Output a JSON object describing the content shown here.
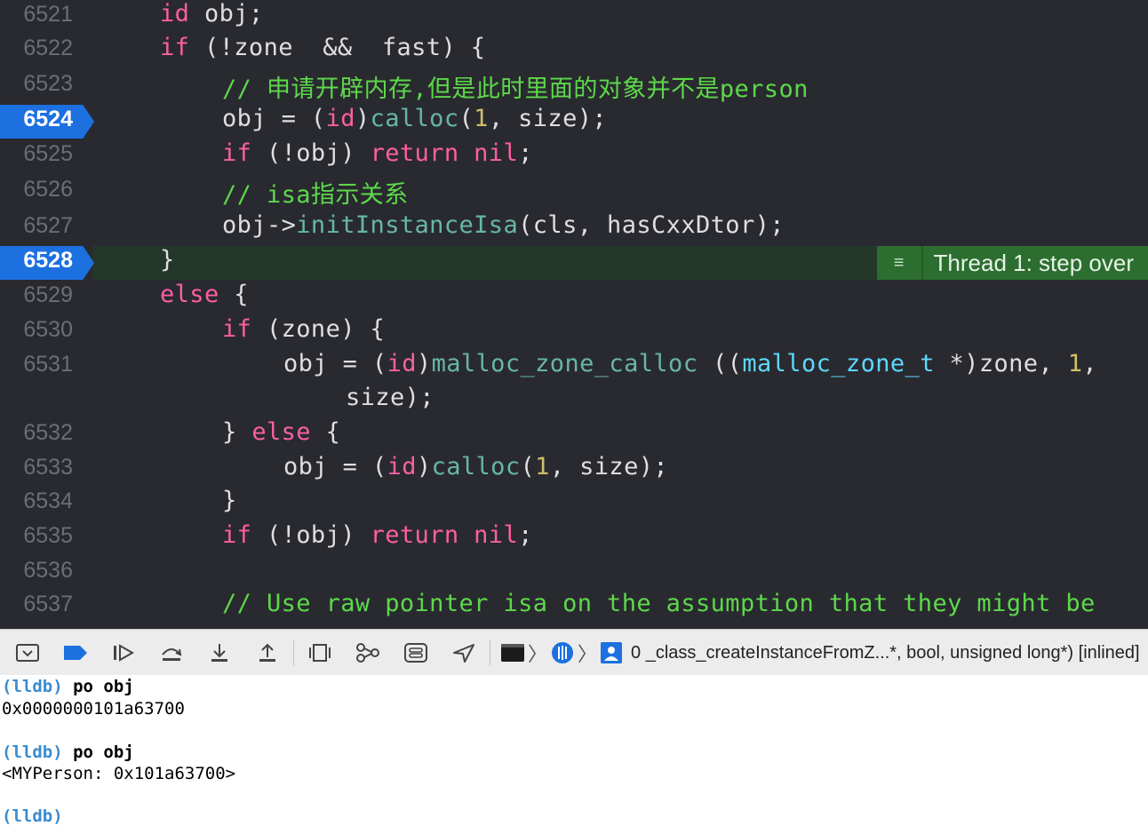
{
  "editor": {
    "lines": [
      {
        "num": "6521"
      },
      {
        "num": "6522"
      },
      {
        "num": "6523"
      },
      {
        "num": "6524",
        "current": true
      },
      {
        "num": "6525"
      },
      {
        "num": "6526"
      },
      {
        "num": "6527"
      },
      {
        "num": "6528",
        "current": true
      },
      {
        "num": "6529"
      },
      {
        "num": "6530"
      },
      {
        "num": "6531"
      },
      {
        "num": "6532"
      },
      {
        "num": "6533"
      },
      {
        "num": "6534"
      },
      {
        "num": "6535"
      },
      {
        "num": "6536"
      },
      {
        "num": "6537"
      }
    ],
    "code": {
      "l6521": {
        "kw": "id",
        "rest": " obj;"
      },
      "l6522": {
        "kw": "if",
        "rest": " (!zone  &&  fast) {"
      },
      "l6523": {
        "comment_prefix": "// ",
        "comment_text": "申请开辟内存,但是此时里面的对象并不是person"
      },
      "l6524": {
        "a": "obj = (",
        "kw": "id",
        "b": ")",
        "fn": "calloc",
        "c": "(",
        "num": "1",
        "d": ", size);"
      },
      "l6525": {
        "kw": "if",
        "a": " (!obj) ",
        "kw2": "return",
        "sp": " ",
        "kw3": "nil",
        "b": ";"
      },
      "l6526": {
        "comment": "// isa指示关系"
      },
      "l6527": {
        "a": "obj->",
        "fn": "initInstanceIsa",
        "b": "(cls, hasCxxDtor);"
      },
      "l6528": {
        "text": "}"
      },
      "l6529": {
        "kw": "else",
        "rest": " {"
      },
      "l6530": {
        "kw": "if",
        "rest": " (zone) {"
      },
      "l6531": {
        "a": "obj = (",
        "kw": "id",
        "b": ")",
        "fn": "malloc_zone_calloc",
        "c": " ((",
        "tp": "malloc_zone_t",
        "d": " *)zone, ",
        "num": "1",
        "e": ","
      },
      "l6531b": {
        "text": "size);"
      },
      "l6532": {
        "a": "} ",
        "kw": "else",
        "b": " {"
      },
      "l6533": {
        "a": "obj = (",
        "kw": "id",
        "b": ")",
        "fn": "calloc",
        "c": "(",
        "num": "1",
        "d": ", size);"
      },
      "l6534": {
        "text": "}"
      },
      "l6535": {
        "kw": "if",
        "a": " (!obj) ",
        "kw2": "return",
        "sp": " ",
        "kw3": "nil",
        "b": ";"
      },
      "l6537": {
        "comment": "// Use raw pointer isa on the assumption that they might be"
      }
    },
    "thread_badge": {
      "text": "Thread 1: step over",
      "menu_icon": "≡"
    }
  },
  "toolbar": {
    "frame_label": "0 _class_createInstanceFromZ...*, bool, unsigned long*) [inlined]",
    "crumb_chevron": "〉"
  },
  "console": {
    "lines": [
      {
        "prompt": "(lldb)",
        "cmd": " po obj"
      },
      {
        "out": "0x0000000101a63700"
      },
      {
        "prompt": "(lldb)",
        "cmd": " po obj"
      },
      {
        "out": "<MYPerson: 0x101a63700>"
      },
      {
        "prompt": "(lldb)",
        "cmd": ""
      }
    ]
  },
  "colors": {
    "editor_bg": "#292a30",
    "keyword": "#fc5fa3",
    "function": "#67b7a4",
    "number": "#d0bf69",
    "comment_cn": "#5dd84a",
    "current_line": "#1c70e0",
    "thread_badge": "#2c6e2f"
  }
}
